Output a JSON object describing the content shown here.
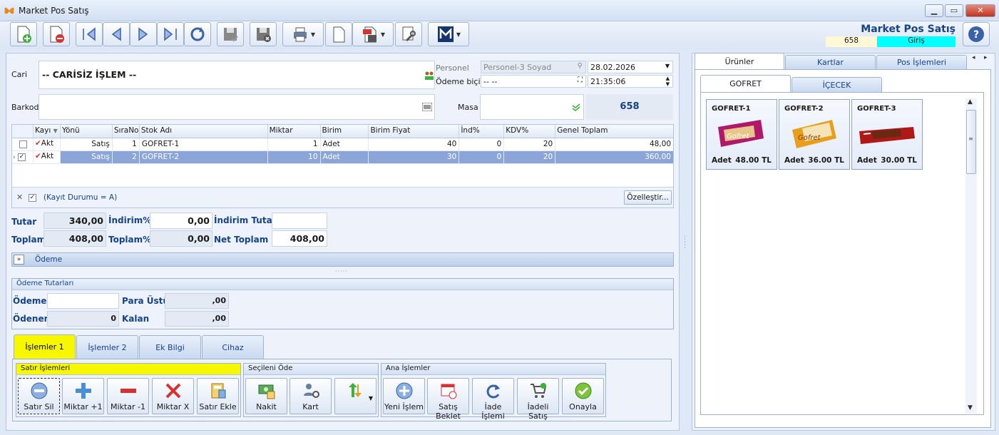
{
  "window": {
    "title": "Market Pos Satış"
  },
  "header": {
    "brand": "Market Pos Satış",
    "terminal": "658",
    "mode": "Giriş"
  },
  "cari": {
    "label": "Cari",
    "value": "-- CARİSİZ İŞLEM --"
  },
  "barkod": {
    "label": "Barkod",
    "value": ""
  },
  "personel": {
    "label": "Personel",
    "value": "Personel-3 Soyad"
  },
  "odeme_bicimi": {
    "label": "Ödeme biçimi",
    "value": "-- --"
  },
  "date": "28.02.2026",
  "time": "21:35:06",
  "masa": {
    "label": "Masa",
    "value": "",
    "number": "658"
  },
  "grid": {
    "columns": [
      "Kayı",
      "Yönü",
      "SıraNo",
      "Stok Adı",
      "Miktar",
      "Birim",
      "Birim Fiyat",
      "İnd%",
      "KDV%",
      "Genel Toplam"
    ],
    "rows": [
      {
        "kayit": "Akt",
        "yonu": "Satış",
        "sirano": "1",
        "stok": "GOFRET-1",
        "miktar": "1",
        "birim": "Adet",
        "fiyat": "40",
        "ind": "0",
        "kdv": "20",
        "toplam": "48,00",
        "checked": false
      },
      {
        "kayit": "Akt",
        "yonu": "Satış",
        "sirano": "2",
        "stok": "GOFRET-2",
        "miktar": "10",
        "birim": "Adet",
        "fiyat": "30",
        "ind": "0",
        "kdv": "20",
        "toplam": "360,00",
        "checked": true
      }
    ],
    "filter": "(Kayıt Durumu = A)",
    "customize": "Özelleştir..."
  },
  "totals": {
    "tutar_label": "Tutar",
    "tutar": "340,00",
    "indirim_label": "İndirim%",
    "indirim": "0,00",
    "indirim_tutar_label": "İndirim Tutar",
    "indirim_tutar": "",
    "toplam_label": "Toplam",
    "toplam": "408,00",
    "toplam_pct_label": "Toplam%",
    "toplam_pct": "0,00",
    "net_label": "Net Toplam",
    "net": "408,00"
  },
  "odeme_bar": "Ödeme",
  "odeme_tutarlari": {
    "title": "Ödeme Tutarları",
    "odeme_label": "Ödeme",
    "odeme": "",
    "para_ustu_label": "Para Üstü",
    "para_ustu": ",00",
    "odenen_label": "Ödenen",
    "odenen": "0",
    "kalan_label": "Kalan",
    "kalan": ",00"
  },
  "bottom_tabs": [
    "İşlemler 1",
    "İşlemler 2",
    "Ek Bilgi",
    "Cihaz"
  ],
  "groups": {
    "satir": {
      "title": "Satır İşlemleri",
      "buttons": [
        "Satır Sil",
        "Miktar +1",
        "Miktar -1",
        "Miktar X",
        "Satır Ekle"
      ]
    },
    "secileni": {
      "title": "Seçileni Öde",
      "buttons": [
        "Nakit",
        "Kart"
      ]
    },
    "ana": {
      "title": "Ana İşlemler",
      "buttons": [
        "Yeni İşlem",
        "Satış Beklet",
        "İade İşlemi",
        "İadeli Satış",
        "Onayla"
      ]
    }
  },
  "right_tabs": [
    "Ürünler",
    "Kartlar",
    "Pos İşlemleri"
  ],
  "category_tabs": [
    "GOFRET",
    "İÇECEK"
  ],
  "products": [
    {
      "name": "GOFRET-1",
      "unit": "Adet",
      "price": "48.00 TL"
    },
    {
      "name": "GOFRET-2",
      "unit": "Adet",
      "price": "36.00 TL"
    },
    {
      "name": "GOFRET-3",
      "unit": "Adet",
      "price": "30.00 TL"
    }
  ],
  "colors": {
    "accent": "#15428b",
    "selection": "#8ca5d9",
    "terminal_bg": "#fff8d6",
    "mode_bg": "#00ffff",
    "active_tab": "#f7f700"
  }
}
